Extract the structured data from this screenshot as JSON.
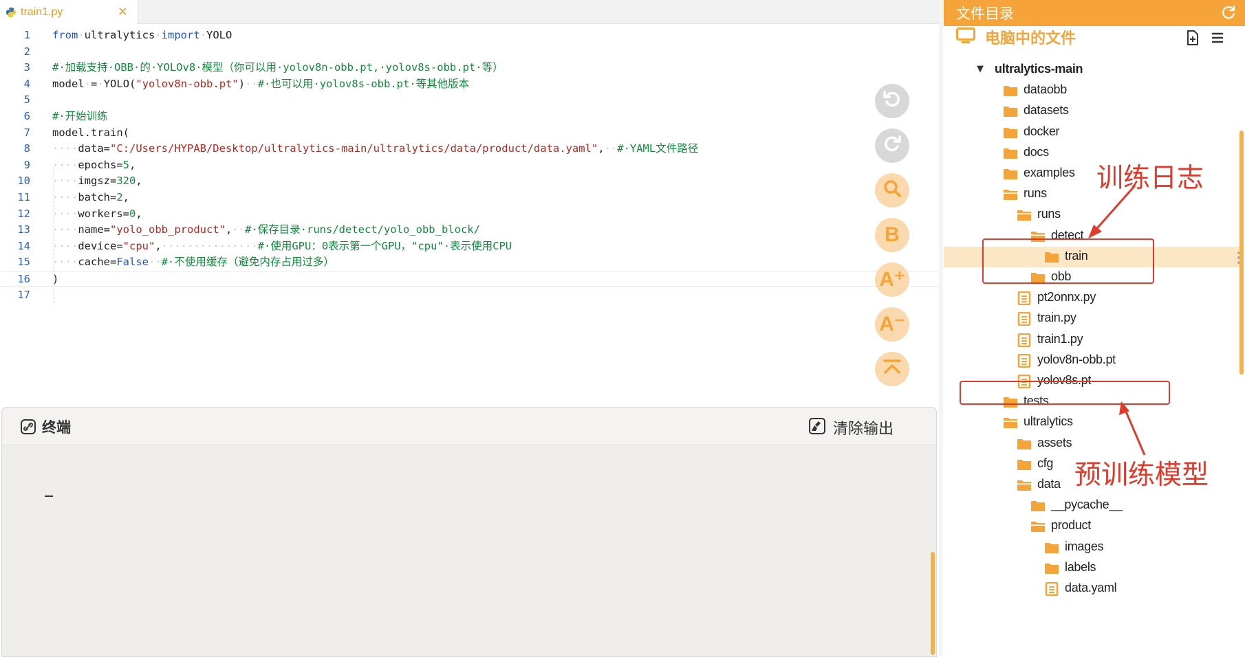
{
  "editor": {
    "tab": {
      "filename": "train1.py",
      "close": "×"
    },
    "lines": [
      {
        "n": "1",
        "tokens": [
          {
            "t": "from",
            "c": "kw"
          },
          {
            "t": "·",
            "c": "dot"
          },
          {
            "t": "ultralytics",
            "c": ""
          },
          {
            "t": "·",
            "c": "dot"
          },
          {
            "t": "import",
            "c": "kw"
          },
          {
            "t": "·",
            "c": "dot"
          },
          {
            "t": "YOLO",
            "c": ""
          }
        ]
      },
      {
        "n": "2",
        "tokens": []
      },
      {
        "n": "3",
        "tokens": [
          {
            "t": "#·加载支持·OBB·的·YOLOv8·模型（你可以用·yolov8n-obb.pt,·yolov8s-obb.pt·等）",
            "c": "cm"
          }
        ]
      },
      {
        "n": "4",
        "tokens": [
          {
            "t": "model",
            "c": ""
          },
          {
            "t": "·",
            "c": "dot"
          },
          {
            "t": "=",
            "c": ""
          },
          {
            "t": "·",
            "c": "dot"
          },
          {
            "t": "YOLO(",
            "c": ""
          },
          {
            "t": "\"yolov8n-obb.pt\"",
            "c": "str"
          },
          {
            "t": ")",
            "c": ""
          },
          {
            "t": "··",
            "c": "dot"
          },
          {
            "t": "#·也可以用·yolov8s-obb.pt·等其他版本",
            "c": "cm"
          }
        ]
      },
      {
        "n": "5",
        "tokens": []
      },
      {
        "n": "6",
        "tokens": [
          {
            "t": "#·开始训练",
            "c": "cm"
          }
        ]
      },
      {
        "n": "7",
        "tokens": [
          {
            "t": "model.train(",
            "c": ""
          }
        ]
      },
      {
        "n": "8",
        "tokens": [
          {
            "t": "····",
            "c": "dot"
          },
          {
            "t": "data=",
            "c": ""
          },
          {
            "t": "\"C:/Users/HYPAB/Desktop/ultralytics-main/ultralytics/data/product/data.yaml\"",
            "c": "str"
          },
          {
            "t": ",",
            "c": ""
          },
          {
            "t": "··",
            "c": "dot"
          },
          {
            "t": "#·YAML文件路径",
            "c": "cm"
          }
        ]
      },
      {
        "n": "9",
        "tokens": [
          {
            "t": "····",
            "c": "dot"
          },
          {
            "t": "epochs=",
            "c": ""
          },
          {
            "t": "5",
            "c": "num"
          },
          {
            "t": ",",
            "c": ""
          }
        ]
      },
      {
        "n": "10",
        "tokens": [
          {
            "t": "····",
            "c": "dot"
          },
          {
            "t": "imgsz=",
            "c": ""
          },
          {
            "t": "320",
            "c": "num"
          },
          {
            "t": ",",
            "c": ""
          }
        ]
      },
      {
        "n": "11",
        "tokens": [
          {
            "t": "····",
            "c": "dot"
          },
          {
            "t": "batch=",
            "c": ""
          },
          {
            "t": "2",
            "c": "num"
          },
          {
            "t": ",",
            "c": ""
          }
        ]
      },
      {
        "n": "12",
        "tokens": [
          {
            "t": "····",
            "c": "dot"
          },
          {
            "t": "workers=",
            "c": ""
          },
          {
            "t": "0",
            "c": "num"
          },
          {
            "t": ",",
            "c": ""
          }
        ]
      },
      {
        "n": "13",
        "tokens": [
          {
            "t": "····",
            "c": "dot"
          },
          {
            "t": "name=",
            "c": ""
          },
          {
            "t": "\"yolo_obb_product\"",
            "c": "str"
          },
          {
            "t": ",",
            "c": ""
          },
          {
            "t": "··",
            "c": "dot"
          },
          {
            "t": "#·保存目录·runs/detect/yolo_obb_block/",
            "c": "cm"
          }
        ]
      },
      {
        "n": "14",
        "tokens": [
          {
            "t": "····",
            "c": "dot"
          },
          {
            "t": "device=",
            "c": ""
          },
          {
            "t": "\"cpu\"",
            "c": "str"
          },
          {
            "t": ",",
            "c": ""
          },
          {
            "t": "···············",
            "c": "dot"
          },
          {
            "t": "#·使用GPU：0表示第一个GPU，\"cpu\"·表示使用CPU",
            "c": "cm"
          }
        ]
      },
      {
        "n": "15",
        "tokens": [
          {
            "t": "····",
            "c": "dot"
          },
          {
            "t": "cache=",
            "c": ""
          },
          {
            "t": "False",
            "c": "kw"
          },
          {
            "t": "··",
            "c": "dot"
          },
          {
            "t": "#·不使用缓存（避免内存占用过多）",
            "c": "cm"
          }
        ]
      },
      {
        "n": "16",
        "tokens": [
          {
            "t": ")",
            "c": ""
          }
        ]
      },
      {
        "n": "17",
        "tokens": []
      }
    ]
  },
  "floating_buttons": [
    {
      "name": "undo-button",
      "icon": "undo-icon",
      "glyph": "↶",
      "style": "gray"
    },
    {
      "name": "redo-button",
      "icon": "redo-icon",
      "glyph": "↷",
      "style": "gray"
    },
    {
      "name": "search-button",
      "icon": "search-icon",
      "glyph": "",
      "style": "orange"
    },
    {
      "name": "bold-button",
      "icon": "bold-icon",
      "glyph": "B",
      "style": "orange"
    },
    {
      "name": "font-increase-button",
      "icon": "font-increase-icon",
      "glyph": "A⁺",
      "style": "orange"
    },
    {
      "name": "font-decrease-button",
      "icon": "font-decrease-icon",
      "glyph": "A⁻",
      "style": "orange"
    },
    {
      "name": "scroll-top-button",
      "icon": "scroll-top-icon",
      "glyph": "",
      "style": "orange"
    }
  ],
  "terminal": {
    "title": "终端",
    "clear_label": "清除输出",
    "cursor": "_"
  },
  "file_tree": {
    "title": "文件目录",
    "computer_label": "电脑中的文件",
    "items": [
      {
        "label": "ultralytics-main",
        "type": "root"
      },
      {
        "label": "dataobb",
        "type": "folder"
      },
      {
        "label": "datasets",
        "type": "folder"
      },
      {
        "label": "docker",
        "type": "folder"
      },
      {
        "label": "docs",
        "type": "folder"
      },
      {
        "label": "examples",
        "type": "folder"
      },
      {
        "label": "runs",
        "type": "folder-open"
      },
      {
        "label": "runs",
        "type": "folder-open"
      },
      {
        "label": "detect",
        "type": "folder-open"
      },
      {
        "label": "train",
        "type": "folder",
        "selected": true
      },
      {
        "label": "obb",
        "type": "folder"
      },
      {
        "label": "pt2onnx.py",
        "type": "file"
      },
      {
        "label": "train.py",
        "type": "file"
      },
      {
        "label": "train1.py",
        "type": "file"
      },
      {
        "label": "yolov8n-obb.pt",
        "type": "file"
      },
      {
        "label": "yolov8s.pt",
        "type": "file"
      },
      {
        "label": "tests",
        "type": "folder"
      },
      {
        "label": "ultralytics",
        "type": "folder-open"
      },
      {
        "label": "assets",
        "type": "folder"
      },
      {
        "label": "cfg",
        "type": "folder"
      },
      {
        "label": "data",
        "type": "folder-open"
      },
      {
        "label": "__pycache__",
        "type": "folder"
      },
      {
        "label": "product",
        "type": "folder-open"
      },
      {
        "label": "images",
        "type": "folder"
      },
      {
        "label": "labels",
        "type": "folder"
      },
      {
        "label": "data.yaml",
        "type": "file"
      }
    ]
  },
  "annotations": {
    "training_log": "训练日志",
    "pretrained_model": "预训练模型"
  },
  "colors": {
    "accent": "#f5a43a",
    "annotation": "#e23a2a",
    "selected_row": "#fbe6c6"
  }
}
